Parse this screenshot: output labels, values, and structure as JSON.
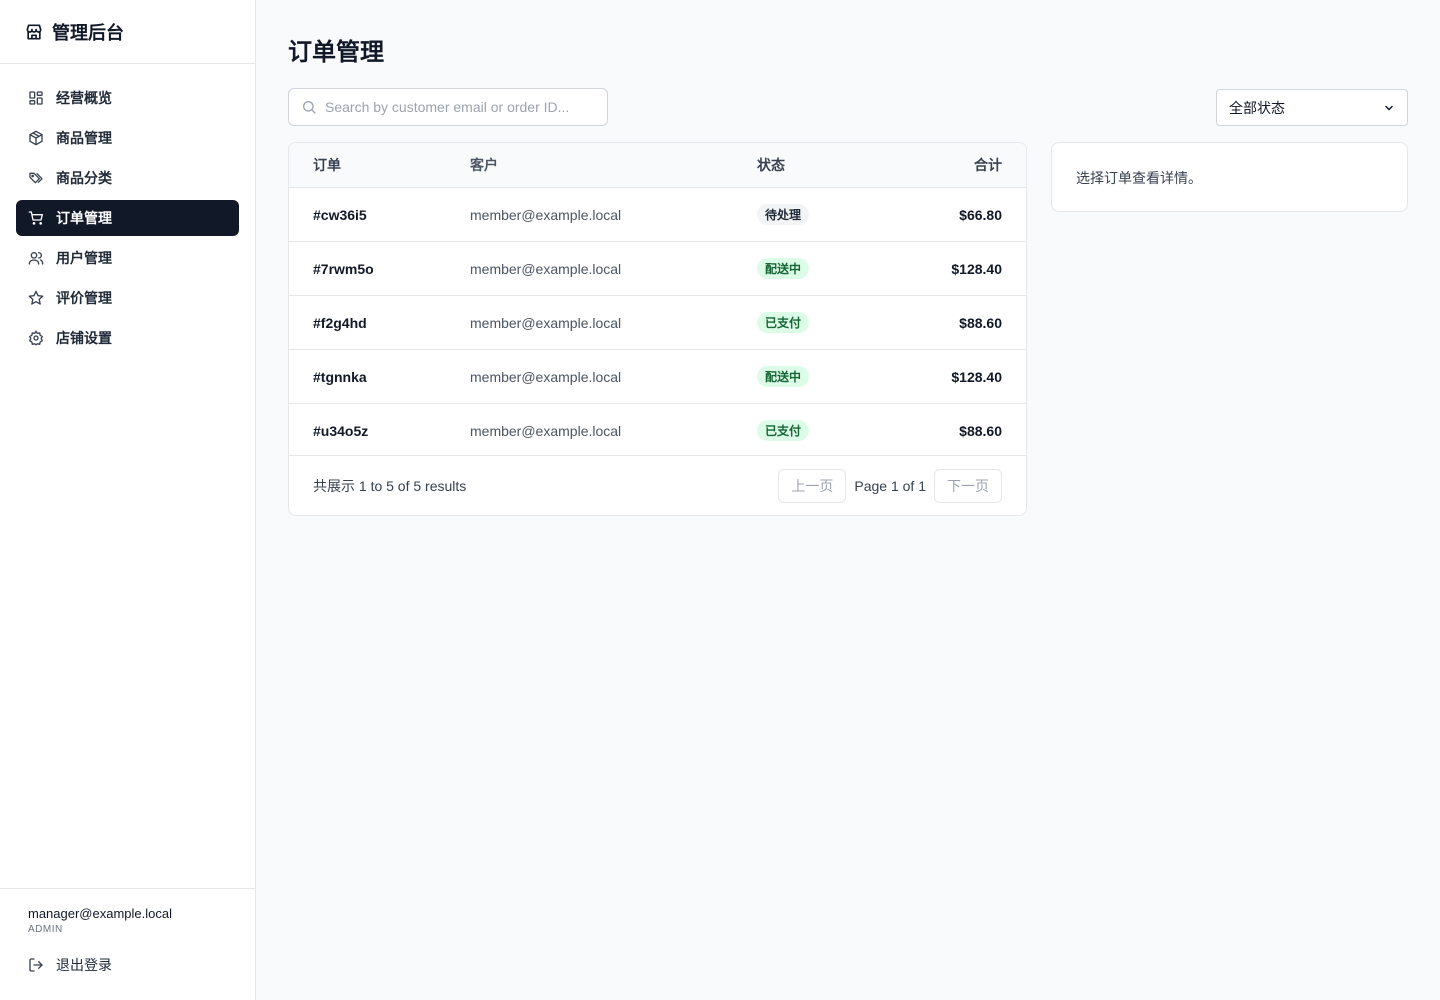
{
  "app": {
    "title": "管理后台",
    "icons": {
      "brand": "store-icon",
      "search": "search-icon",
      "select_caret": "chevron-down-icon",
      "logout": "logout-icon"
    },
    "colors": {
      "sidebar_active_bg": "#111827",
      "badge_green_bg": "#dcfce7",
      "badge_green_text": "#166534",
      "badge_gray_bg": "#f3f4f6"
    }
  },
  "sidebar": {
    "items": [
      {
        "label": "经营概览",
        "icon": "grid-icon"
      },
      {
        "label": "商品管理",
        "icon": "box-icon"
      },
      {
        "label": "商品分类",
        "icon": "tags-icon"
      },
      {
        "label": "订单管理",
        "icon": "cart-icon",
        "active": true
      },
      {
        "label": "用户管理",
        "icon": "users-icon"
      },
      {
        "label": "评价管理",
        "icon": "star-icon"
      },
      {
        "label": "店铺设置",
        "icon": "gear-icon"
      }
    ],
    "user": {
      "email": "manager@example.local",
      "role": "ADMIN"
    },
    "logout_label": "退出登录"
  },
  "main": {
    "title": "订单管理",
    "search": {
      "placeholder": "Search by customer email or order ID...",
      "value": ""
    },
    "status_filter": {
      "selected": "全部状态"
    },
    "table": {
      "headers": [
        "订单",
        "客户",
        "状态",
        "合计"
      ],
      "rows": [
        {
          "id": "#cw36i5",
          "customer": "member@example.local",
          "status": "待处理",
          "status_kind": "pending",
          "total": "$66.80"
        },
        {
          "id": "#7rwm5o",
          "customer": "member@example.local",
          "status": "配送中",
          "status_kind": "shipping",
          "total": "$128.40"
        },
        {
          "id": "#f2g4hd",
          "customer": "member@example.local",
          "status": "已支付",
          "status_kind": "paid",
          "total": "$88.60"
        },
        {
          "id": "#tgnnka",
          "customer": "member@example.local",
          "status": "配送中",
          "status_kind": "shipping",
          "total": "$128.40"
        },
        {
          "id": "#u34o5z",
          "customer": "member@example.local",
          "status": "已支付",
          "status_kind": "paid",
          "total": "$88.60"
        }
      ],
      "summary": "共展示 1 to 5 of 5 results",
      "prev_label": "上一页",
      "page_info": "Page 1 of 1",
      "next_label": "下一页"
    },
    "detail": {
      "empty_text": "选择订单查看详情。"
    }
  }
}
